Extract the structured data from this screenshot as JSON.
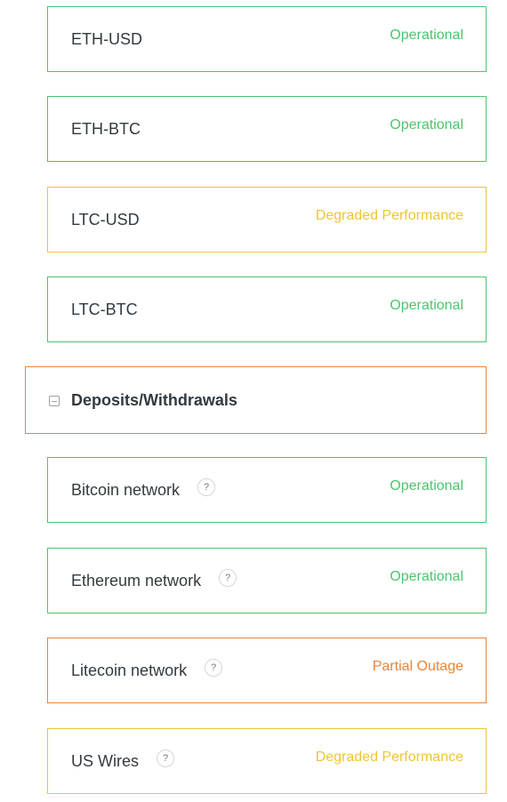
{
  "components": [
    {
      "name": "ETH-USD",
      "status": "Operational"
    },
    {
      "name": "ETH-BTC",
      "status": "Operational"
    },
    {
      "name": "LTC-USD",
      "status": "Degraded Performance"
    },
    {
      "name": "LTC-BTC",
      "status": "Operational"
    }
  ],
  "group": {
    "title": "Deposits/Withdrawals",
    "toggle_icon": "minus-square-icon",
    "items": [
      {
        "name": "Bitcoin network",
        "help": "?",
        "status": "Operational"
      },
      {
        "name": "Ethereum network",
        "help": "?",
        "status": "Operational"
      },
      {
        "name": "Litecoin network",
        "help": "?",
        "status": "Partial Outage"
      },
      {
        "name": "US Wires",
        "help": "?",
        "status": "Degraded Performance"
      }
    ]
  },
  "colors": {
    "operational": "#4cc56a",
    "degraded": "#f0c531",
    "partial_outage": "#e8843a"
  }
}
